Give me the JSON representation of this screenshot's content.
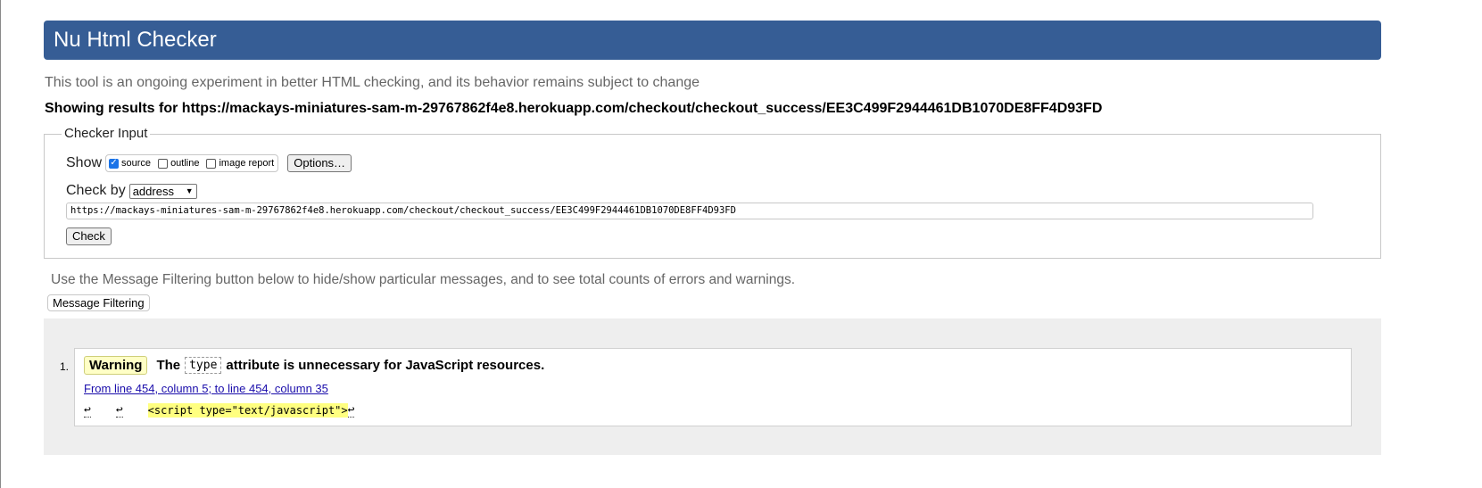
{
  "header": {
    "title": "Nu Html Checker"
  },
  "intro_text": "This tool is an ongoing experiment in better HTML checking, and its behavior remains subject to change",
  "showing_results": "Showing results for https://mackays-miniatures-sam-m-29767862f4e8.herokuapp.com/checkout/checkout_success/EE3C499F2944461DB1070DE8FF4D93FD",
  "checker_input": {
    "legend": "Checker Input",
    "show_label": "Show",
    "options": [
      {
        "label": "source",
        "checked": true
      },
      {
        "label": "outline",
        "checked": false
      },
      {
        "label": "image report",
        "checked": false
      }
    ],
    "options_button": "Options…",
    "check_by_label": "Check by",
    "check_by_value": "address",
    "url_value": "https://mackays-miniatures-sam-m-29767862f4e8.herokuapp.com/checkout/checkout_success/EE3C499F2944461DB1070DE8FF4D93FD",
    "check_button": "Check"
  },
  "filter_note": "Use the Message Filtering button below to hide/show particular messages, and to see total counts of errors and warnings.",
  "filter_button": "Message Filtering",
  "messages": [
    {
      "number": "1.",
      "type": "Warning",
      "text_before": "The",
      "code": "type",
      "text_after": "attribute is unnecessary for JavaScript resources.",
      "location": "From line 454, column 5; to line 454, column 35",
      "extract_linefeed": "↩",
      "extract_code": "<script type=\"text/javascript\">"
    }
  ],
  "colors": {
    "header_bg": "#365d95",
    "warning_bg": "#ffffc6",
    "highlight": "#ffff80"
  }
}
